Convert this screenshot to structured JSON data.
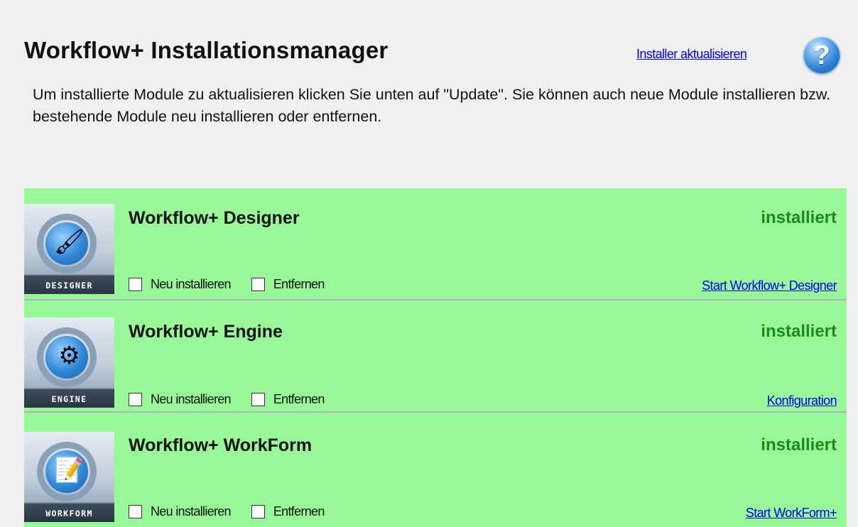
{
  "header": {
    "title": "Workflow+ Installationsmanager",
    "update_installer_link": "Installer aktualisieren",
    "help_icon_glyph": "?"
  },
  "intro": {
    "text": "Um installierte Module zu aktualisieren klicken Sie unten auf \"Update\". Sie können auch neue Module installieren bzw. bestehende Module neu installieren oder entfernen."
  },
  "modules": [
    {
      "name": "Workflow+ Designer",
      "status": "installiert",
      "icon_label": "DESIGNER",
      "icon_name": "designer-icon",
      "reinstall_label": "Neu installieren",
      "remove_label": "Entfernen",
      "action_link": "Start Workflow+ Designer"
    },
    {
      "name": "Workflow+ Engine",
      "status": "installiert",
      "icon_label": "ENGINE",
      "icon_name": "engine-icon",
      "reinstall_label": "Neu installieren",
      "remove_label": "Entfernen",
      "action_link": "Konfiguration"
    },
    {
      "name": "Workflow+ WorkForm",
      "status": "installiert",
      "icon_label": "WORKFORM",
      "icon_name": "workform-icon",
      "reinstall_label": "Neu installieren",
      "remove_label": "Entfernen",
      "action_link": "Start WorkForm+"
    }
  ],
  "colors": {
    "module_background": "#98f898",
    "status_green": "#1c8a1c",
    "link_blue": "#0000ee"
  }
}
